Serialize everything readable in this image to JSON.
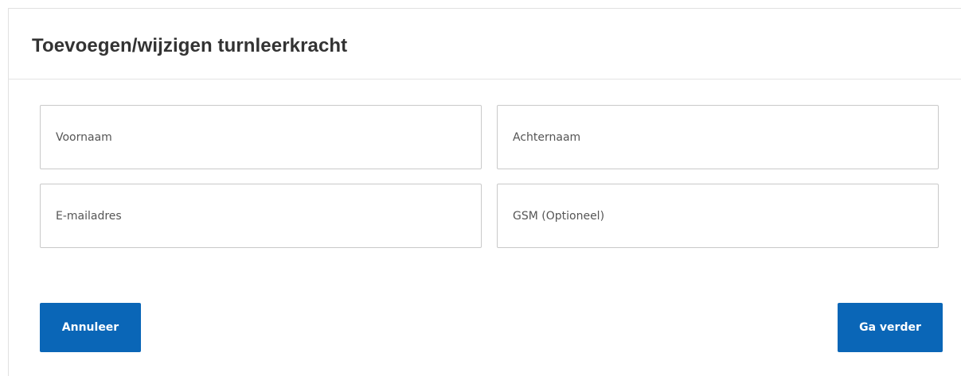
{
  "modal": {
    "title": "Toevoegen/wijzigen turnleerkracht"
  },
  "form": {
    "first_name": {
      "value": "",
      "placeholder": "Voornaam"
    },
    "last_name": {
      "value": "",
      "placeholder": "Achternaam"
    },
    "email": {
      "value": "",
      "placeholder": "E-mailadres"
    },
    "phone": {
      "value": "",
      "placeholder": "GSM (Optioneel)"
    }
  },
  "actions": {
    "cancel_label": "Annuleer",
    "continue_label": "Ga verder"
  },
  "colors": {
    "primary_button": "#0a66b7",
    "field_border": "#c9c9c9",
    "title_text": "#333333"
  }
}
